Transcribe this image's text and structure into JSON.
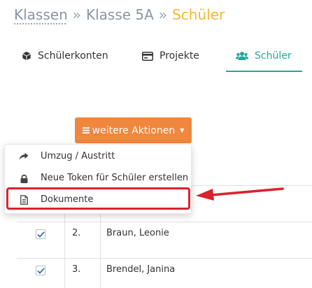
{
  "breadcrumb": {
    "items": [
      "Klassen",
      "Klasse 5A"
    ],
    "separator": "»",
    "current": "Schüler"
  },
  "tabs": [
    {
      "label": "Schülerkonten",
      "icon": "cube-icon",
      "active": false
    },
    {
      "label": "Projekte",
      "icon": "card-icon",
      "active": false
    },
    {
      "label": "Schüler",
      "icon": "users-icon",
      "active": true
    }
  ],
  "actions": {
    "label": "weitere Aktionen",
    "icon": "bars-icon",
    "caret": "caret-down-icon",
    "color": "#f0873e"
  },
  "dropdown": {
    "items": [
      {
        "label": "Umzug / Austritt",
        "icon": "share-arrow-icon"
      },
      {
        "label": "Neue Token für Schüler erstellen",
        "icon": "lock-icon"
      },
      {
        "label": "Dokumente",
        "icon": "document-icon"
      }
    ]
  },
  "table": {
    "rows": [
      {
        "num": "2.",
        "name": "Braun, Leonie",
        "checked": true
      },
      {
        "num": "3.",
        "name": "Brendel, Janina",
        "checked": true
      }
    ]
  },
  "colors": {
    "accent": "#1fa99a",
    "current_crumb": "#f5b92e",
    "highlight": "#d9232d",
    "check": "#2a6fb5"
  }
}
